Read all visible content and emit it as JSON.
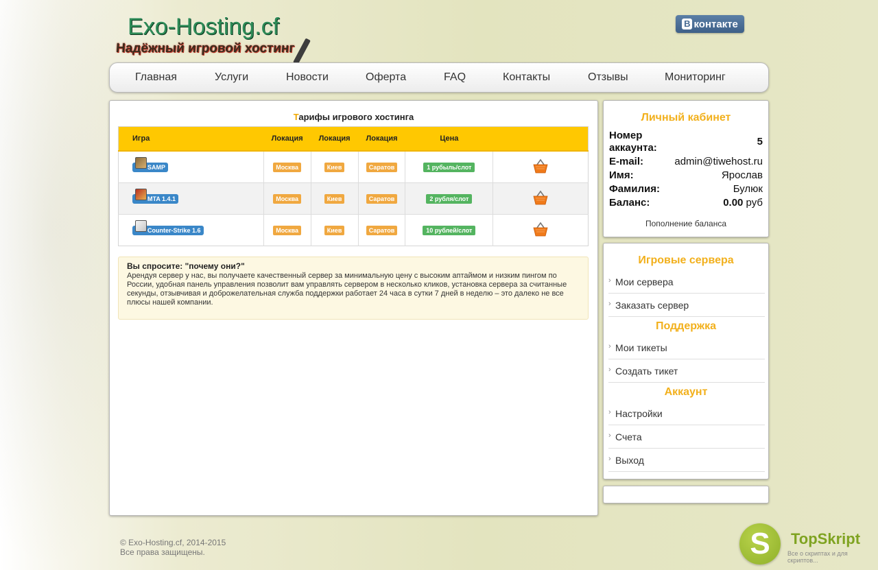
{
  "header": {
    "logo_text": "Exo-Hosting.cf",
    "slogan": "Надёжный игровой хостинг",
    "vk_prefix": "В",
    "vk_label": "контакте"
  },
  "nav": [
    "Главная",
    "Услуги",
    "Новости",
    "Оферта",
    "FAQ",
    "Контакты",
    "Отзывы",
    "Мониторинг"
  ],
  "main": {
    "title_first": "Т",
    "title_rest": "арифы игрового хостинга",
    "columns": [
      "Игра",
      "Локация",
      "Локация",
      "Локация",
      "Цена",
      ""
    ],
    "rows": [
      {
        "game": "SAMP",
        "loc1": "Москва",
        "loc2": "Киев",
        "loc3": "Саратов",
        "price": "1 рубыль/слот"
      },
      {
        "game": "MTA 1.4.1",
        "loc1": "Москва",
        "loc2": "Киев",
        "loc3": "Саратов",
        "price": "2 рубля/слот"
      },
      {
        "game": "Counter-Strike 1.6",
        "loc1": "Москва",
        "loc2": "Киев",
        "loc3": "Саратов",
        "price": "10 рублей/слот"
      }
    ],
    "info_title": "Вы спросите: \"почему они?\"",
    "info_text": "Арендуя сервер у нас, вы получаете качественный сервер за минимальную цену с высоким аптаймом и низким пингом по России, удобная панель управления позволит вам управлять сервером в несколько кликов, установка сервера за считанные секунды, отзывчивая и доброжелательная служба поддержки работает 24 часа в сутки 7 дней в неделю – это далеко не все плюсы нашей компании."
  },
  "account": {
    "title": "Личный кабинет",
    "number_label_1": "Номер",
    "number_label_2": "аккаунта:",
    "number_value": "5",
    "email_label": "E-mail:",
    "email_value": "admin@tiwehost.ru",
    "name_label": "Имя:",
    "name_value": "Ярослав",
    "surname_label": "Фамилия:",
    "surname_value": "Булюк",
    "balance_label": "Баланс:",
    "balance_value": "0.00",
    "balance_unit": " руб",
    "topup": "Пополнение баланса"
  },
  "menu": {
    "servers_title": "Игровые сервера",
    "my_servers": "Мои сервера",
    "order_server": "Заказать сервер",
    "support_title": "Поддержка",
    "my_tickets": "Мои тикеты",
    "create_ticket": "Создать тикет",
    "account_title": "Аккаунт",
    "settings": "Настройки",
    "bills": "Счета",
    "logout": "Выход"
  },
  "footer": {
    "line1": "© Exo-Hosting.cf, 2014-2015",
    "line2": "Все права защищены."
  },
  "watermark": {
    "letter": "S",
    "name": "TopSkript",
    "sub": "Все о скриптах и для скриптов..."
  }
}
